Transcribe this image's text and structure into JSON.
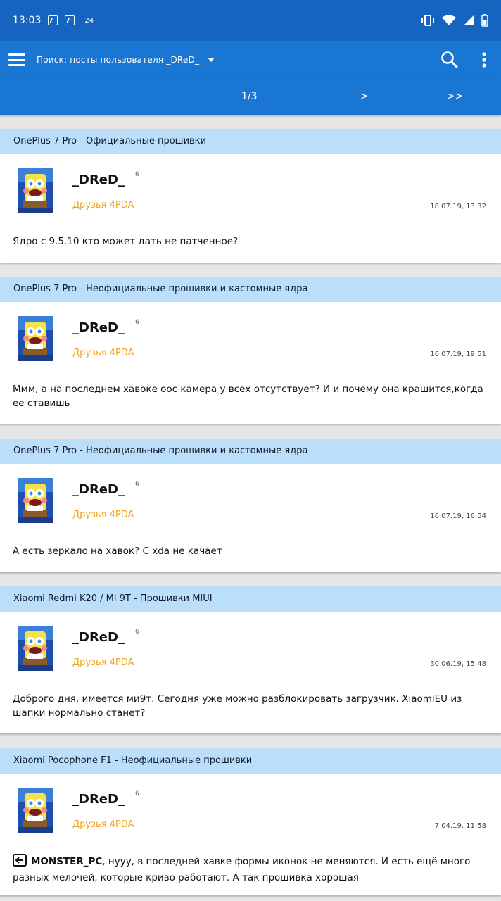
{
  "status_bar": {
    "time": "13:03",
    "notification_count": "24"
  },
  "toolbar": {
    "title": "Поиск: посты пользователя _DReD_"
  },
  "pager": {
    "current": "1/3",
    "next": ">",
    "last": ">>"
  },
  "posts": [
    {
      "topic": "OnePlus 7 Pro - Официальные прошивки",
      "author": "_DReD_",
      "reputation": "6",
      "group": "Друзья 4PDA",
      "date": "18.07.19, 13:32",
      "text": "Ядро с 9.5.10 кто может дать не патченное?"
    },
    {
      "topic": "OnePlus 7 Pro - Неофициальные прошивки и кастомные ядра",
      "author": "_DReD_",
      "reputation": "6",
      "group": "Друзья 4PDA",
      "date": "16.07.19, 19:51",
      "text": "Ммм, а на последнем хавоке оос камера у всех отсутствует? И и почему она крашится,когда ее ставишь"
    },
    {
      "topic": "OnePlus 7 Pro - Неофициальные прошивки и кастомные ядра",
      "author": "_DReD_",
      "reputation": "6",
      "group": "Друзья 4PDA",
      "date": "16.07.19, 16:54",
      "text": "А есть зеркало на хавок? С xda не качает"
    },
    {
      "topic": "Xiaomi Redmi K20 / Mi 9T - Прошивки MIUI",
      "author": "_DReD_",
      "reputation": "6",
      "group": "Друзья 4PDA",
      "date": "30.06.19, 15:48",
      "text": "Доброго дня, имеется ми9т. Сегодня уже можно разблокировать загрузчик. XiaomiEU из шапки нормально станет?"
    },
    {
      "topic": "Xiaomi Pocophone F1 - Неофициальные прошивки",
      "author": "_DReD_",
      "reputation": "6",
      "group": "Друзья 4PDA",
      "date": "7.04.19, 11:58",
      "quote_author": "MONSTER_PC",
      "text": ", нууу, в последней хавке формы иконок не меняются. И есть ещё много разных мелочей, которые криво работают. А так прошивка хорошая"
    }
  ],
  "colors": {
    "status_bar": "#1565c0",
    "toolbar": "#1976d2",
    "topic_bg": "#bbdefb",
    "group_text": "#f0a31f"
  }
}
